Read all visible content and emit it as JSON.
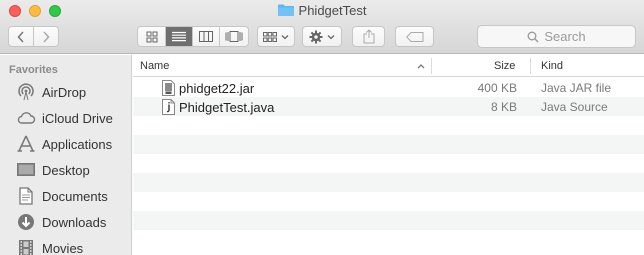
{
  "window": {
    "title": "PhidgetTest"
  },
  "toolbar": {
    "back_icon": "chevron-left-icon",
    "forward_icon": "chevron-right-icon",
    "view_modes": [
      "icon-view-icon",
      "list-view-icon",
      "column-view-icon",
      "cover-flow-icon"
    ],
    "active_view": "list-view-icon",
    "arrange_icon": "arrange-grid-icon",
    "action_icon": "gear-icon",
    "share_icon": "share-icon",
    "tag_icon": "tag-icon",
    "search_placeholder": "Search"
  },
  "sidebar": {
    "section_title": "Favorites",
    "items": [
      {
        "label": "AirDrop",
        "icon": "airdrop-icon"
      },
      {
        "label": "iCloud Drive",
        "icon": "cloud-icon"
      },
      {
        "label": "Applications",
        "icon": "applications-icon"
      },
      {
        "label": "Desktop",
        "icon": "desktop-icon"
      },
      {
        "label": "Documents",
        "icon": "documents-icon"
      },
      {
        "label": "Downloads",
        "icon": "downloads-icon"
      },
      {
        "label": "Movies",
        "icon": "movies-icon"
      }
    ]
  },
  "file_list": {
    "columns": {
      "name": "Name",
      "size": "Size",
      "kind": "Kind"
    },
    "sort_indicator": "chevron-up-icon",
    "rows": [
      {
        "name": "phidget22.jar",
        "size": "400 KB",
        "kind": "Java JAR file",
        "icon": "jar-file-icon"
      },
      {
        "name": "PhidgetTest.java",
        "size": "8 KB",
        "kind": "Java Source",
        "icon": "java-file-icon"
      }
    ]
  },
  "colors": {
    "folder_blue": "#5fb4f4",
    "active_segment": "#6f6f6f",
    "close": "#fc605b",
    "minimize": "#fdbc40",
    "maximize": "#34c84a"
  }
}
